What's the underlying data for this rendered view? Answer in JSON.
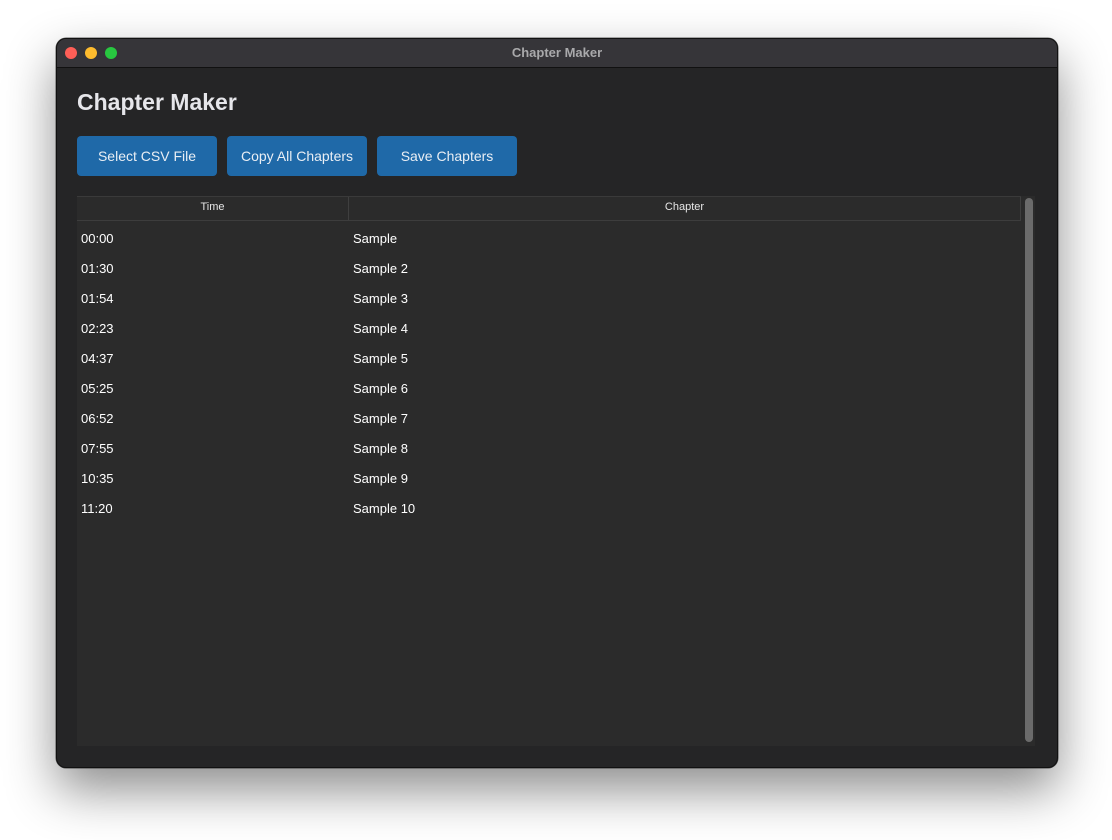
{
  "window": {
    "title": "Chapter Maker"
  },
  "app": {
    "heading": "Chapter Maker"
  },
  "toolbar": {
    "select_csv_label": "Select CSV File",
    "copy_all_label": "Copy All Chapters",
    "save_label": "Save Chapters"
  },
  "table": {
    "columns": [
      "Time",
      "Chapter"
    ],
    "rows": [
      {
        "time": "00:00",
        "chapter": "Sample"
      },
      {
        "time": "01:30",
        "chapter": "Sample 2"
      },
      {
        "time": "01:54",
        "chapter": "Sample 3"
      },
      {
        "time": "02:23",
        "chapter": "Sample 4"
      },
      {
        "time": "04:37",
        "chapter": "Sample 5"
      },
      {
        "time": "05:25",
        "chapter": "Sample 6"
      },
      {
        "time": "06:52",
        "chapter": "Sample 7"
      },
      {
        "time": "07:55",
        "chapter": "Sample 8"
      },
      {
        "time": "10:35",
        "chapter": "Sample 9"
      },
      {
        "time": "11:20",
        "chapter": "Sample 10"
      }
    ]
  },
  "colors": {
    "window_bg": "#252526",
    "titlebar_bg": "#363539",
    "button_bg": "#1f69a8",
    "table_bg": "#2b2b2b",
    "traffic_close": "#fe5f57",
    "traffic_minimize": "#febc2e",
    "traffic_maximize": "#28c840"
  }
}
